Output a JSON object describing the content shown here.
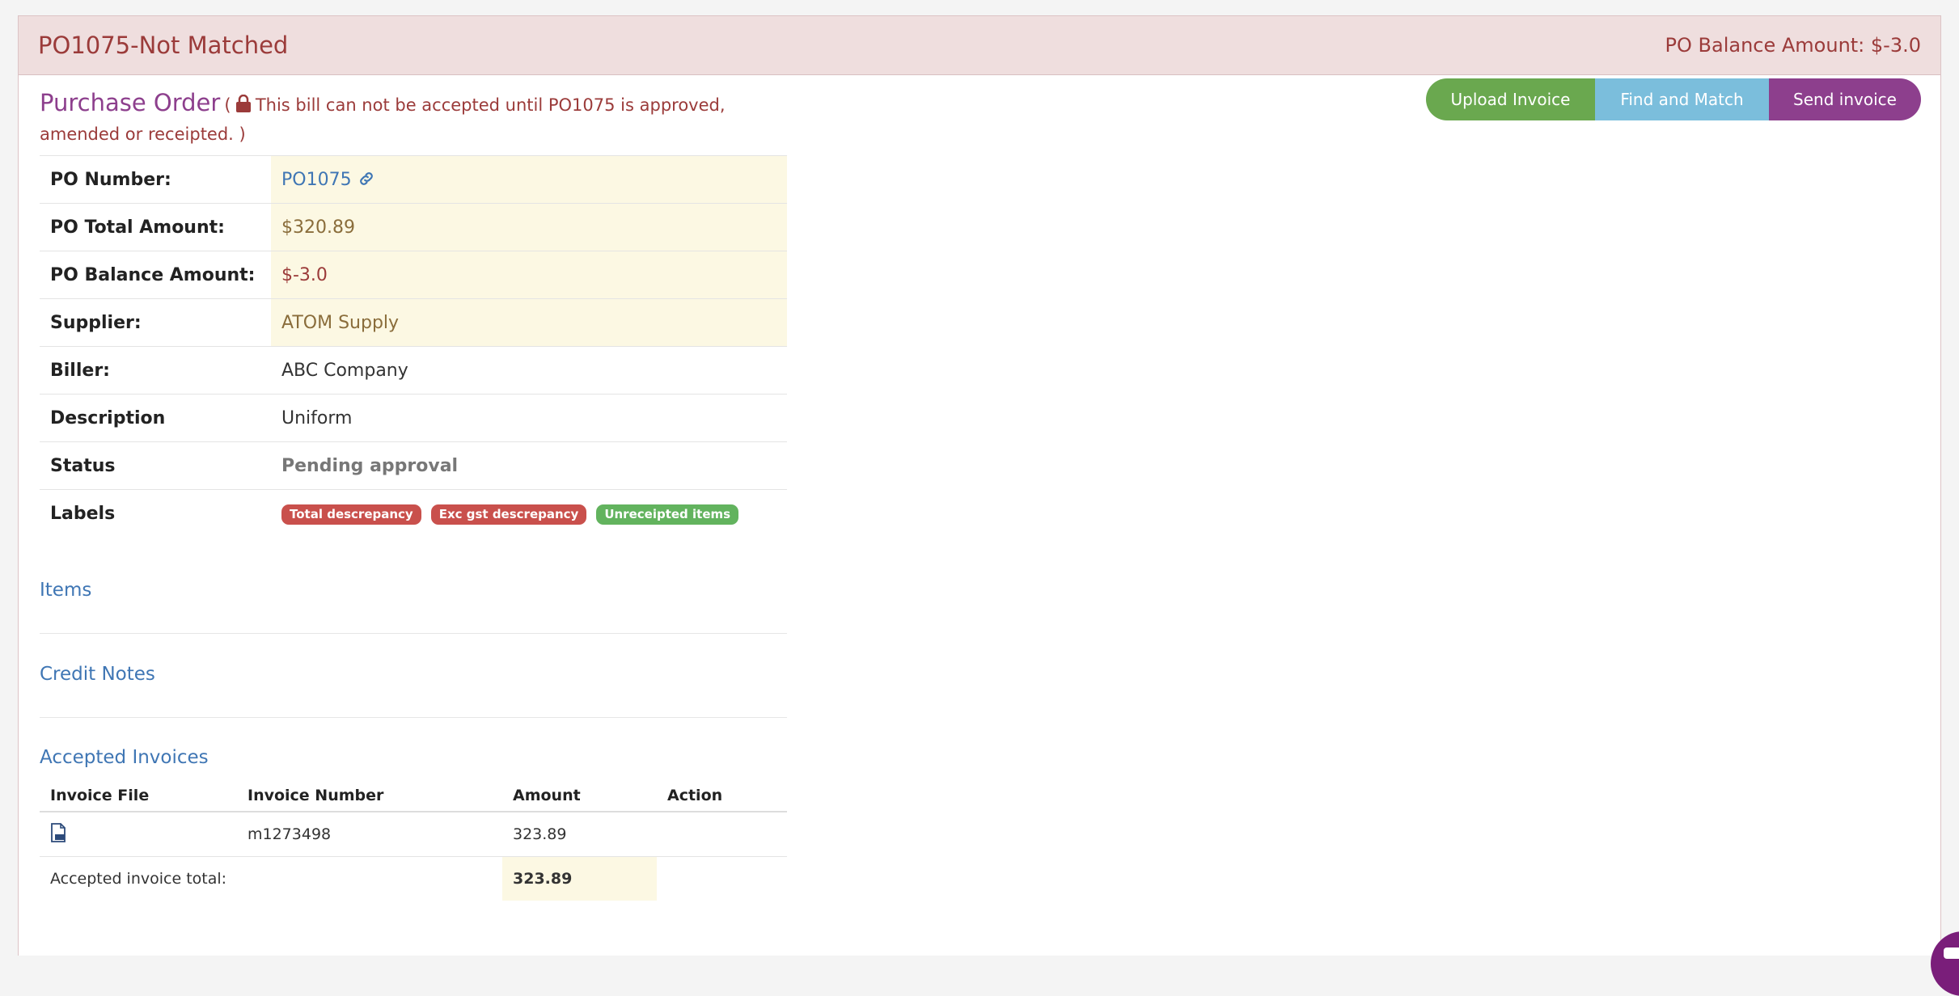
{
  "header": {
    "title": "PO1075-Not Matched",
    "balance": "PO Balance Amount: $-3.0"
  },
  "actions": {
    "upload": "Upload Invoice",
    "find": "Find and Match",
    "send": "Send invoice"
  },
  "po": {
    "title": "Purchase Order",
    "open_paren": "(",
    "note": "This bill can not be accepted until PO1075 is approved, amended or receipted. )"
  },
  "details": {
    "po_number_label": "PO Number:",
    "po_number": "PO1075",
    "total_label": "PO Total Amount:",
    "total": "$320.89",
    "balance_label": "PO Balance Amount:",
    "balance": "$-3.0",
    "supplier_label": "Supplier:",
    "supplier": "ATOM Supply",
    "biller_label": "Biller:",
    "biller": "ABC Company",
    "description_label": "Description",
    "description": "Uniform",
    "status_label": "Status",
    "status": "Pending approval",
    "labels_label": "Labels",
    "labels": [
      "Total descrepancy",
      "Exc gst descrepancy",
      "Unreceipted items"
    ]
  },
  "sections": {
    "items": "Items",
    "credit_notes": "Credit Notes",
    "accepted_invoices": "Accepted Invoices"
  },
  "invoices": {
    "columns": [
      "Invoice File",
      "Invoice Number",
      "Amount",
      "Action"
    ],
    "rows": [
      {
        "file_icon": "pdf-file-icon",
        "number": "m1273498",
        "amount": "323.89",
        "action": ""
      }
    ],
    "total_label": "Accepted invoice total:",
    "total": "323.89"
  },
  "colors": {
    "header_bg": "#efdede",
    "accent_red": "#9b3b3a",
    "purple": "#8d3f8d",
    "green": "#6aa84f",
    "light_blue": "#7bbedc",
    "link_blue": "#3f76b4",
    "highlight": "#fcf8e3"
  },
  "icons": {
    "lock": "lock-icon",
    "link": "link-icon",
    "chat": "chat-icon"
  }
}
